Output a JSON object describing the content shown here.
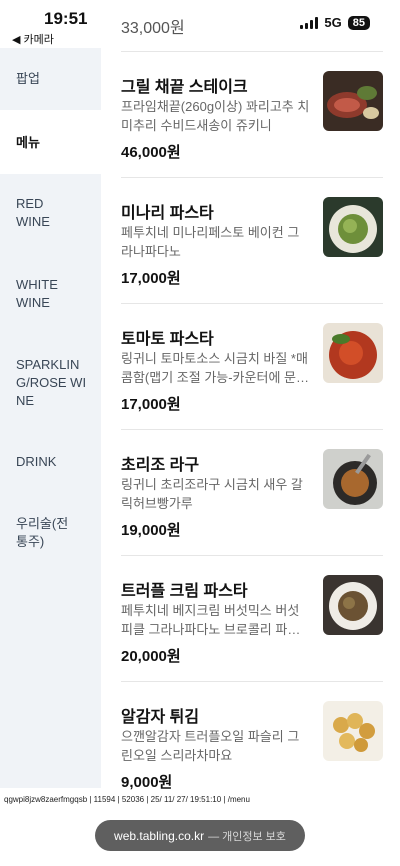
{
  "status": {
    "time": "19:51",
    "back_label": "◀ 카메라",
    "network": "5G",
    "battery": "85"
  },
  "sidebar": {
    "items": [
      {
        "label": "팝업",
        "active": false
      },
      {
        "label": "메뉴",
        "active": true
      },
      {
        "label": "RED WINE",
        "active": false
      },
      {
        "label": "WHITE WINE",
        "active": false
      },
      {
        "label": "SPARKLING/ROSE WINE",
        "active": false
      },
      {
        "label": "DRINK",
        "active": false
      },
      {
        "label": "우리술(전통주)",
        "active": false
      }
    ]
  },
  "menu": {
    "partial_price": "33,000원",
    "items": [
      {
        "name": "그릴 채끝 스테이크",
        "desc": "프라임채끝(260g이상) 꽈리고추 치미추리 수비드새송이 쥬키니",
        "price": "46,000원"
      },
      {
        "name": "미나리 파스타",
        "desc": "페투치네 미나리페스토 베이컨 그라나파다노",
        "price": "17,000원"
      },
      {
        "name": "토마토 파스타",
        "desc": "링귀니 토마토소스 시금치 바질 *매콤함(맵기 조절 가능-카운터에 문의)",
        "price": "17,000원"
      },
      {
        "name": "초리조 라구",
        "desc": "링귀니 초리조라구 시금치 새우 갈릭허브빵가루",
        "price": "19,000원"
      },
      {
        "name": "트러플 크림 파스타",
        "desc": "페투치네 베지크림 버섯믹스 버섯피클 그라나파다노 브로콜리 파슬리",
        "price": "20,000원"
      },
      {
        "name": "알감자 튀김",
        "desc": "으깬알감자 트러플오일 파슬리 그린오일 스리라차마요",
        "price": "9,000원"
      }
    ]
  },
  "footer": {
    "debug": "qgwpi8jzw8zaerfmgqsb | 11594 | 52036 | 25/ 11/ 27/ 19:51:10 | /menu",
    "url": "web.tabling.co.kr",
    "url_suffix": "— 개인정보 보호"
  }
}
